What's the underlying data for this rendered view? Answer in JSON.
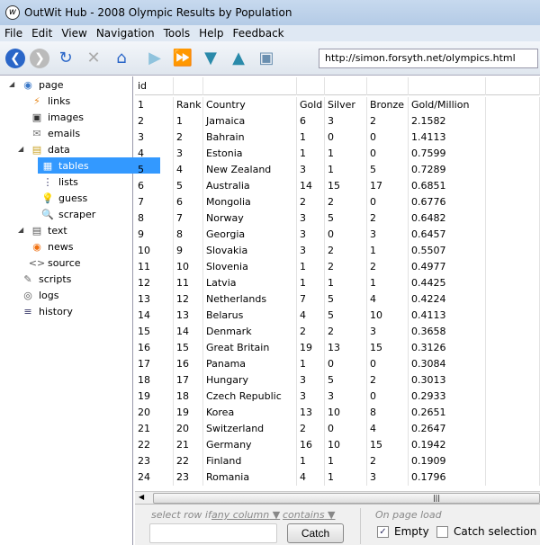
{
  "window": {
    "title": "OutWit Hub - 2008 Olympic Results by Population"
  },
  "menu": [
    "File",
    "Edit",
    "View",
    "Navigation",
    "Tools",
    "Help",
    "Feedback"
  ],
  "toolbar": {
    "url": "http://simon.forsyth.net/olympics.html"
  },
  "sidebar": {
    "items": [
      {
        "label": "page",
        "icon": "globe-icon",
        "level": 0,
        "expanded": true
      },
      {
        "label": "links",
        "icon": "links-icon",
        "level": 1
      },
      {
        "label": "images",
        "icon": "images-icon",
        "level": 1
      },
      {
        "label": "emails",
        "icon": "email-icon",
        "level": 1
      },
      {
        "label": "data",
        "icon": "data-icon",
        "level": 1,
        "expanded": true
      },
      {
        "label": "tables",
        "icon": "table-icon",
        "level": 2,
        "selected": true
      },
      {
        "label": "lists",
        "icon": "list-icon",
        "level": 2
      },
      {
        "label": "guess",
        "icon": "lightbulb-icon",
        "level": 2
      },
      {
        "label": "scraper",
        "icon": "magnifier-icon",
        "level": 2
      },
      {
        "label": "text",
        "icon": "text-icon",
        "level": 1,
        "expanded": true
      },
      {
        "label": "news",
        "icon": "rss-icon",
        "level": 1
      },
      {
        "label": "source",
        "icon": "source-icon",
        "level": 1
      },
      {
        "label": "scripts",
        "icon": "scripts-icon",
        "level": 0
      },
      {
        "label": "logs",
        "icon": "logs-icon",
        "level": 0
      },
      {
        "label": "history",
        "icon": "history-icon",
        "level": 0
      }
    ]
  },
  "table": {
    "header": [
      "id",
      "",
      "",
      "",
      "",
      "",
      "",
      ""
    ],
    "rows": [
      [
        "1",
        "Rank",
        "Country",
        "Gold",
        "Silver",
        "Bronze",
        "Gold/Million"
      ],
      [
        "2",
        "1",
        "Jamaica",
        "6",
        "3",
        "2",
        "2.1582"
      ],
      [
        "3",
        "2",
        "Bahrain",
        "1",
        "0",
        "0",
        "1.4113"
      ],
      [
        "4",
        "3",
        "Estonia",
        "1",
        "1",
        "0",
        "0.7599"
      ],
      [
        "5",
        "4",
        "New Zealand",
        "3",
        "1",
        "5",
        "0.7289"
      ],
      [
        "6",
        "5",
        "Australia",
        "14",
        "15",
        "17",
        "0.6851"
      ],
      [
        "7",
        "6",
        "Mongolia",
        "2",
        "2",
        "0",
        "0.6776"
      ],
      [
        "8",
        "7",
        "Norway",
        "3",
        "5",
        "2",
        "0.6482"
      ],
      [
        "9",
        "8",
        "Georgia",
        "3",
        "0",
        "3",
        "0.6457"
      ],
      [
        "10",
        "9",
        "Slovakia",
        "3",
        "2",
        "1",
        "0.5507"
      ],
      [
        "11",
        "10",
        "Slovenia",
        "1",
        "2",
        "2",
        "0.4977"
      ],
      [
        "12",
        "11",
        "Latvia",
        "1",
        "1",
        "1",
        "0.4425"
      ],
      [
        "13",
        "12",
        "Netherlands",
        "7",
        "5",
        "4",
        "0.4224"
      ],
      [
        "14",
        "13",
        "Belarus",
        "4",
        "5",
        "10",
        "0.4113"
      ],
      [
        "15",
        "14",
        "Denmark",
        "2",
        "2",
        "3",
        "0.3658"
      ],
      [
        "16",
        "15",
        "Great Britain",
        "19",
        "13",
        "15",
        "0.3126"
      ],
      [
        "17",
        "16",
        "Panama",
        "1",
        "0",
        "0",
        "0.3084"
      ],
      [
        "18",
        "17",
        "Hungary",
        "3",
        "5",
        "2",
        "0.3013"
      ],
      [
        "19",
        "18",
        "Czech Republic",
        "3",
        "3",
        "0",
        "0.2933"
      ],
      [
        "20",
        "19",
        "Korea",
        "13",
        "10",
        "8",
        "0.2651"
      ],
      [
        "21",
        "20",
        "Switzerland",
        "2",
        "0",
        "4",
        "0.2647"
      ],
      [
        "22",
        "21",
        "Germany",
        "16",
        "10",
        "15",
        "0.1942"
      ],
      [
        "23",
        "22",
        "Finland",
        "1",
        "1",
        "2",
        "0.1909"
      ],
      [
        "24",
        "23",
        "Romania",
        "4",
        "1",
        "3",
        "0.1796"
      ]
    ]
  },
  "bottom": {
    "select_row_if": "select row if",
    "any_column": "any column",
    "contains": "contains",
    "catch": "Catch",
    "on_page_load": "On page load",
    "empty": "Empty",
    "empty_checked": true,
    "catch_selection": "Catch selection",
    "catch_selection_checked": false
  }
}
